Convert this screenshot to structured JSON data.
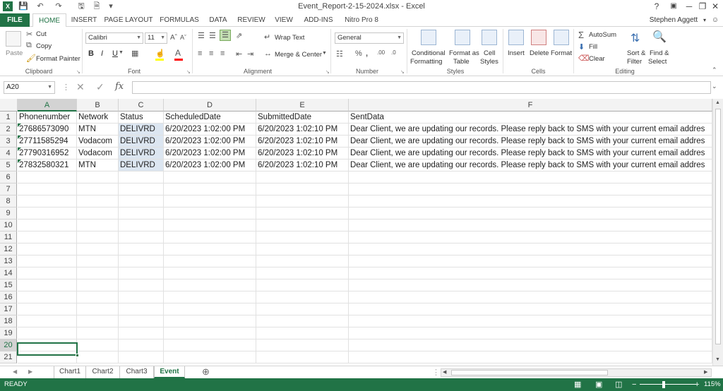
{
  "window": {
    "title": "Event_Report-2-15-2024.xlsx - Excel",
    "user": "Stephen Aggett",
    "controls": [
      "?",
      "▣",
      "─",
      "❐",
      "✕"
    ]
  },
  "ribbon_tabs": [
    "FILE",
    "HOME",
    "INSERT",
    "PAGE LAYOUT",
    "FORMULAS",
    "DATA",
    "REVIEW",
    "VIEW",
    "ADD-INS",
    "Nitro Pro 8"
  ],
  "active_tab": "HOME",
  "ribbon": {
    "clipboard": {
      "paste": "Paste",
      "cut": "Cut",
      "copy": "Copy",
      "format_painter": "Format Painter",
      "label": "Clipboard"
    },
    "font": {
      "name": "Calibri",
      "size": "11",
      "bold": "B",
      "italic": "I",
      "underline": "U",
      "label": "Font"
    },
    "alignment": {
      "wrap": "Wrap Text",
      "merge": "Merge & Center",
      "label": "Alignment"
    },
    "number": {
      "format": "General",
      "label": "Number"
    },
    "styles": {
      "conditional": "Conditional",
      "conditional2": "Formatting",
      "format_table": "Format as",
      "format_table2": "Table",
      "cell_styles": "Cell",
      "cell_styles2": "Styles",
      "label": "Styles"
    },
    "cells": {
      "insert": "Insert",
      "delete": "Delete",
      "format": "Format",
      "label": "Cells"
    },
    "editing": {
      "autosum": "AutoSum",
      "fill": "Fill",
      "clear": "Clear",
      "sort": "Sort &",
      "sort2": "Filter",
      "find": "Find &",
      "find2": "Select",
      "label": "Editing"
    }
  },
  "formula_bar": {
    "name_box": "A20",
    "formula": ""
  },
  "columns": [
    "A",
    "B",
    "C",
    "D",
    "E",
    "F"
  ],
  "rows": [
    "1",
    "2",
    "3",
    "4",
    "5",
    "6",
    "7",
    "8",
    "9",
    "10",
    "11",
    "12",
    "13",
    "14",
    "15",
    "16",
    "17",
    "18",
    "19",
    "20",
    "21"
  ],
  "table": {
    "headers": [
      "Phonenumber",
      "Network",
      "Status",
      "ScheduledDate",
      "SubmittedDate",
      "SentData"
    ],
    "rows": [
      [
        "27686573090",
        "MTN",
        "DELIVRD",
        "6/20/2023 1:02:00 PM",
        "6/20/2023 1:02:10 PM",
        "Dear Client, we are updating our records. Please reply back to SMS with your current email addres"
      ],
      [
        "27711585294",
        "Vodacom",
        "DELIVRD",
        "6/20/2023 1:02:00 PM",
        "6/20/2023 1:02:10 PM",
        "Dear Client, we are updating our records. Please reply back to SMS with your current email addres"
      ],
      [
        "27790316952",
        "Vodacom",
        "DELIVRD",
        "6/20/2023 1:02:00 PM",
        "6/20/2023 1:02:10 PM",
        "Dear Client, we are updating our records. Please reply back to SMS with your current email addres"
      ],
      [
        "27832580321",
        "MTN",
        "DELIVRD",
        "6/20/2023 1:02:00 PM",
        "6/20/2023 1:02:10 PM",
        "Dear Client, we are updating our records. Please reply back to SMS with your current email addres"
      ]
    ]
  },
  "sheets": [
    "Chart1",
    "Chart2",
    "Chart3",
    "Event"
  ],
  "active_sheet": "Event",
  "status": {
    "mode": "READY",
    "zoom": "115%"
  },
  "colors": {
    "accent": "#217346",
    "selection_fill": "#dce6f1"
  }
}
